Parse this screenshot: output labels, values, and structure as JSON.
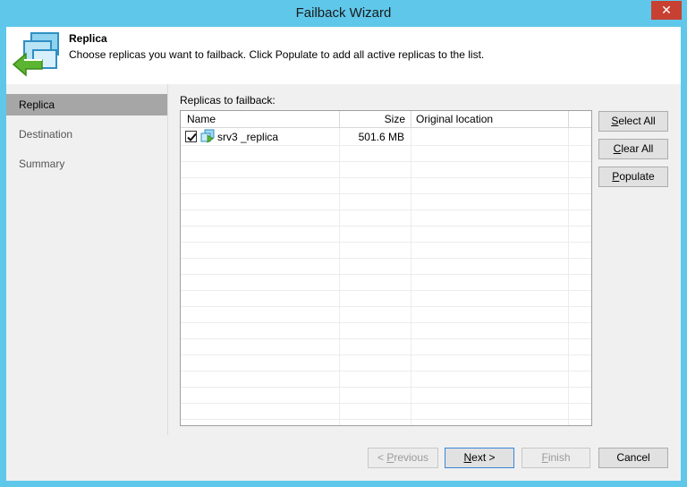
{
  "window": {
    "title": "Failback Wizard",
    "close_glyph": "✕"
  },
  "header": {
    "title": "Replica",
    "description": "Choose replicas you want to failback. Click Populate to add all active replicas to the list.",
    "icon": "replica-failback-icon"
  },
  "sidebar": {
    "items": [
      {
        "label": "Replica",
        "active": true
      },
      {
        "label": "Destination",
        "active": false
      },
      {
        "label": "Summary",
        "active": false
      }
    ]
  },
  "content": {
    "label": "Replicas to failback:",
    "columns": [
      "Name",
      "Size",
      "Original location"
    ],
    "rows": [
      {
        "checked": true,
        "name": "srv3 _replica",
        "size": "501.6 MB",
        "original_location": ""
      }
    ]
  },
  "side_buttons": {
    "select_all": {
      "accel": "S",
      "rest": "elect All"
    },
    "clear_all": {
      "accel": "C",
      "rest": "lear All"
    },
    "populate": {
      "accel": "P",
      "rest": "opulate"
    }
  },
  "footer": {
    "previous": {
      "prefix": "< ",
      "accel": "P",
      "rest": "revious",
      "disabled": true
    },
    "next": {
      "accel": "N",
      "rest": "ext >",
      "disabled": false
    },
    "finish": {
      "accel": "F",
      "rest": "inish",
      "disabled": true
    },
    "cancel": {
      "label": "Cancel",
      "disabled": false
    }
  },
  "colors": {
    "titlebar": "#5fc7ea",
    "close_button": "#c84031",
    "sidebar_active": "#a6a6a6",
    "default_button_border": "#3a85d6"
  }
}
